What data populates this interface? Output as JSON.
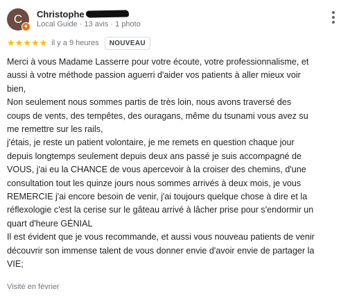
{
  "reviewer": {
    "initial": "C",
    "name": "Christophe",
    "meta": "Local Guide · 13 avis · 1 photo",
    "menu_icon": "more-vert-icon",
    "badge_icon": "local-guide-badge-icon"
  },
  "rating": {
    "stars_text": "★★★★★",
    "stars": 5,
    "time": "il y a 9 heures",
    "badge": "NOUVEAU"
  },
  "review_lines": [
    "Merci à vous Madame Lasserre pour votre écoute, votre professionnalisme, et",
    "aussi à votre méthode passion aguerri d'aider vos patients à aller mieux voir",
    "bien,",
    "Non seulement nous sommes partis de très loin, nous avons traversé des",
    "coups de vents, des tempêtes, des ouragans, même du tsunami vous avez su",
    "me remettre sur les rails,",
    "j'étais, je reste un patient volontaire, je me remets en question chaque jour",
    "depuis longtemps seulement depuis deux ans passé je suis accompagné de",
    "VOUS, j'ai eu la CHANCE de vous apercevoir à la croiser des chemins, d'une",
    "consultation tout les quinze jours nous sommes arrivés à deux mois, je vous",
    "REMERCIE j'ai encore besoin de venir, j'ai toujours quelque chose à dire et la",
    "réflexologie c'est la cerise sur le gâteau arrivé à lâcher prise pour s'endormir un",
    "quart d'heure GÉNIAL",
    "Il est évident que je vous recommande, et aussi vous nouveau patients de venir",
    "découvrir son immense talent de vous donner envie d'avoir envie de partager la",
    "VIE;"
  ],
  "visited": "Visité en février",
  "colors": {
    "star": "#fbbc04",
    "secondary_text": "#70757a",
    "avatar_bg": "#6d4c41",
    "guide_badge": "#e8710a"
  }
}
